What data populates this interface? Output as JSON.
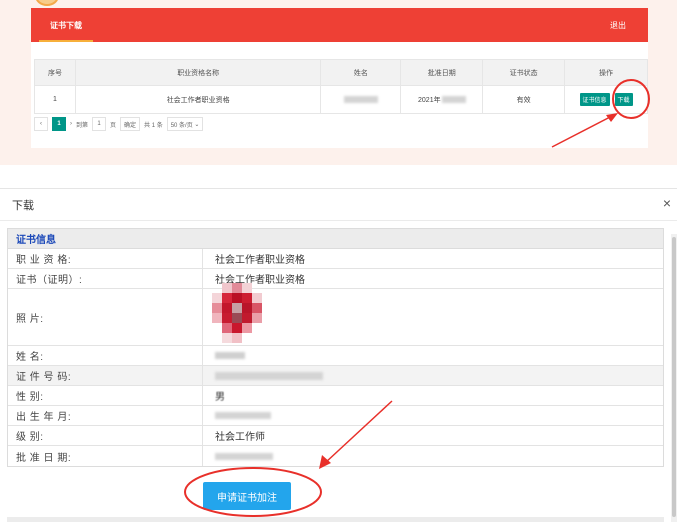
{
  "top": {
    "tab": "证书下载",
    "logout": "退出",
    "table": {
      "headers": [
        "序号",
        "职业资格名称",
        "姓名",
        "批准日期",
        "证书状态",
        "操作"
      ],
      "row": {
        "index": "1",
        "qualification": "社会工作者职业资格",
        "date_prefix": "2021年",
        "status": "有效",
        "btn_info": "证书信息",
        "btn_download": "下载"
      }
    },
    "pager": {
      "current": "1",
      "goto": "到第",
      "page_input": "1",
      "page_unit": "页",
      "confirm": "确定",
      "total": "共 1 条",
      "per_page": "50 条/页"
    }
  },
  "dialog": {
    "title": "下载",
    "close": "×",
    "section": "证书信息",
    "rows": [
      {
        "label": "职 业 资 格:",
        "value": "社会工作者职业资格"
      },
      {
        "label": "证书（证明）:",
        "value": "社会工作者职业资格"
      },
      {
        "label": "照          片:",
        "value": ""
      },
      {
        "label": "姓          名:",
        "value": ""
      },
      {
        "label": "证 件 号 码:",
        "value": ""
      },
      {
        "label": "性          别:",
        "value": "男"
      },
      {
        "label": "出 生 年 月:",
        "value": ""
      },
      {
        "label": "级          别:",
        "value": "社会工作师"
      },
      {
        "label": "批 准 日 期:",
        "value": ""
      }
    ],
    "apply_button": "申请证书加注"
  },
  "colors": {
    "brand_red": "#ee4035",
    "green": "#009688",
    "blue_button": "#23a5ec",
    "annotation": "#e8302a"
  }
}
